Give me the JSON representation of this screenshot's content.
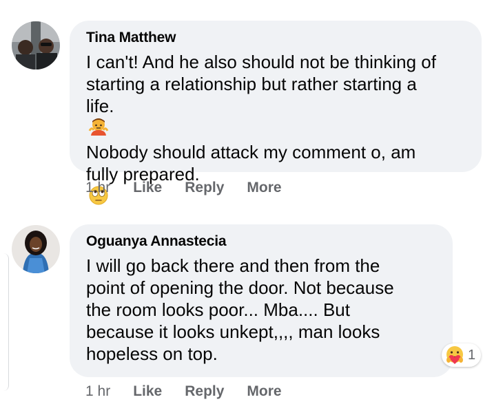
{
  "comments": [
    {
      "author": "Tina Matthew",
      "lines": [
        "I can't! And he also should not be thinking of",
        "starting a relationship but rather starting a",
        "life.",
        "Nobody should attack my comment o, am",
        "fully prepared."
      ],
      "emojis": [
        "shrug-emoji",
        "eye-roll-emoji"
      ],
      "time": "1 hr",
      "like": "Like",
      "reply": "Reply",
      "more": "More"
    },
    {
      "author": "Oguanya Annastecia",
      "lines": [
        "I will go back there and then from the",
        "point of opening the door. Not because",
        "the room looks poor... Mba.... But",
        "because it looks unkept,,,, man looks",
        "hopeless on top."
      ],
      "time": "1 hr",
      "like": "Like",
      "reply": "Reply",
      "more": "More",
      "reaction": {
        "icon": "care-reaction-icon",
        "count": "1"
      }
    }
  ],
  "colors": {
    "bubble": "#f0f2f5",
    "text": "#050505",
    "secondary": "#65676b"
  }
}
